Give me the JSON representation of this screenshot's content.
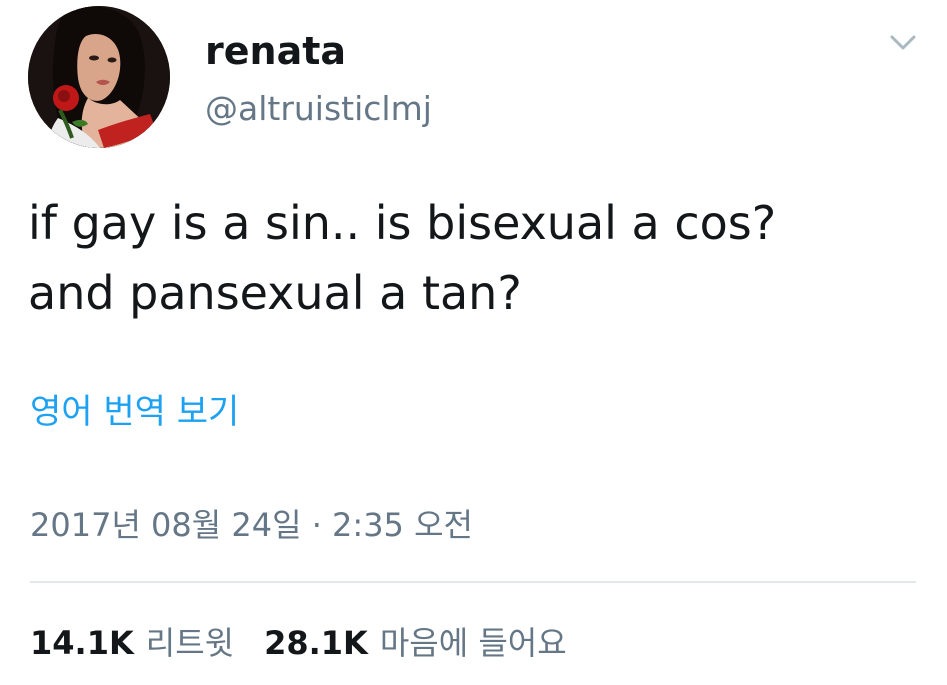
{
  "tweet": {
    "display_name": "renata",
    "handle": "@altruisticlmj",
    "text_lines": [
      "if gay is a sin.. is bisexual a cos?",
      "and pansexual a tan?"
    ],
    "translate_label": "영어 번역 보기",
    "timestamp": "2017년 08월 24일 · 2:35 오전",
    "stats": [
      {
        "count": "14.1K",
        "label": "리트윗"
      },
      {
        "count": "28.1K",
        "label": "마음에 들어요"
      }
    ]
  },
  "icons": {
    "caret": "chevron-down-icon",
    "avatar": "profile-photo"
  },
  "colors": {
    "link": "#1da1f2",
    "secondary_text": "#657786",
    "primary_text": "#14171a",
    "divider": "#e1e8ed"
  }
}
